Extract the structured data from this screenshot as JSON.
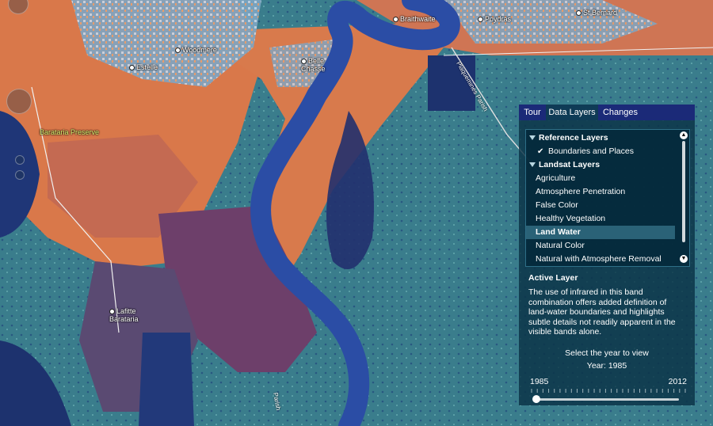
{
  "map": {
    "places": [
      {
        "name": "Braithwaite"
      },
      {
        "name": "Poydras"
      },
      {
        "name": "St Bernard"
      },
      {
        "name": "Woodmere"
      },
      {
        "name": "Estelle"
      },
      {
        "name": "Belle Chasse"
      },
      {
        "name": "Lafitte Barataria"
      }
    ],
    "parks": [
      {
        "name": "Barataria Preserve"
      }
    ],
    "roads": [
      {
        "name": "Plaquemines Parish"
      },
      {
        "name": "Parish"
      }
    ]
  },
  "panel": {
    "tabs": [
      {
        "label": "Tour",
        "active": false
      },
      {
        "label": "Data Layers",
        "active": true
      },
      {
        "label": "Changes",
        "active": false
      }
    ],
    "groups": [
      {
        "label": "Reference Layers",
        "items": [
          {
            "label": "Boundaries and Places",
            "checked": true
          }
        ]
      },
      {
        "label": "Landsat Layers",
        "items": [
          {
            "label": "Agriculture"
          },
          {
            "label": "Atmosphere Penetration"
          },
          {
            "label": "False Color"
          },
          {
            "label": "Healthy Vegetation"
          },
          {
            "label": "Land Water",
            "selected": true
          },
          {
            "label": "Natural Color"
          },
          {
            "label": "Natural with Atmosphere Removal"
          }
        ]
      }
    ],
    "active_layer_title": "Active Layer",
    "active_layer_description": "The use of infrared in this band combination offers added definition of land-water boundaries and highlights subtle details not readily apparent in the visible bands alone.",
    "year_prompt": "Select the year to view",
    "year_label": "Year: 1985",
    "year_min": "1985",
    "year_max": "2012",
    "year_fraction": 0.0
  },
  "colors": {
    "panel_bg": "#0a3246",
    "tab_bar": "#1b2a78",
    "river": "#2d4fa3",
    "land_urban": "#e0804f",
    "marsh": "#3f8c9a",
    "water_dark": "#1b2f6c"
  }
}
